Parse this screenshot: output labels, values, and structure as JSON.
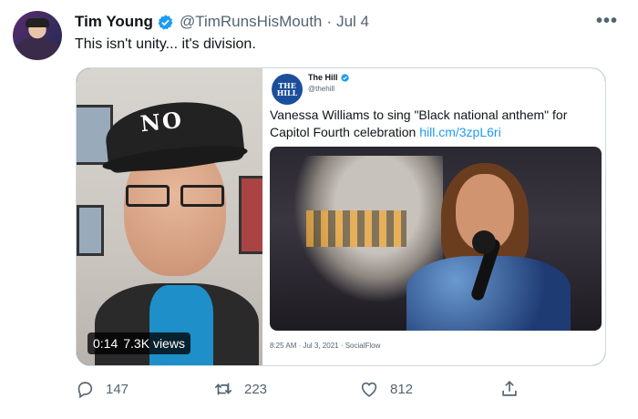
{
  "tweet": {
    "author_name": "Tim Young",
    "handle": "@TimRunsHisMouth",
    "separator": "·",
    "date": "Jul 4",
    "text": "This isn't unity... it's division.",
    "more_icon": "•••"
  },
  "video": {
    "duration": "0:14",
    "views": "7.3K views",
    "cap_text": "NO"
  },
  "quoted": {
    "logo_text": "THE HILL",
    "name": "The Hill",
    "handle": "@thehill",
    "text": "Vanessa Williams to sing \"Black national anthem\" for Capitol Fourth celebration",
    "link": "hill.cm/3zpL6ri",
    "meta": "8:25 AM · Jul 3, 2021 · SocialFlow"
  },
  "actions": {
    "replies": "147",
    "retweets": "223",
    "likes": "812"
  },
  "colors": {
    "verified": "#1d9bf0",
    "secondary_text": "#536471",
    "link": "#1d9bf0"
  }
}
